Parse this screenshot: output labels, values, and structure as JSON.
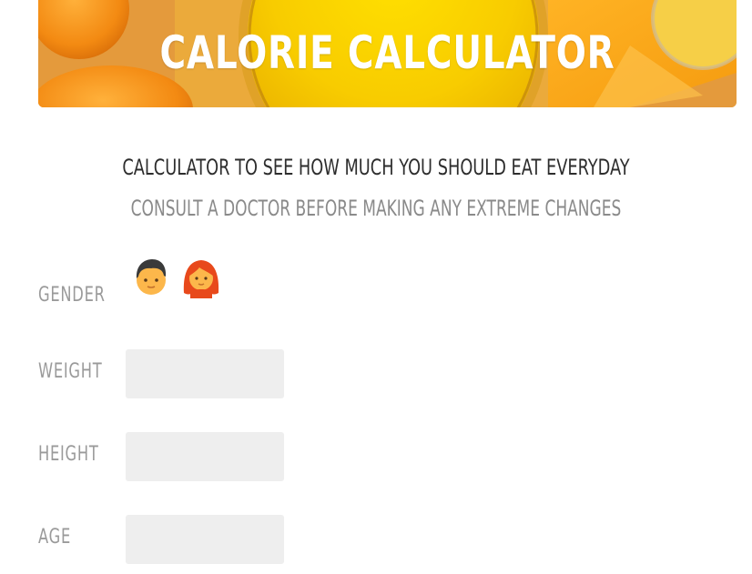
{
  "header": {
    "title": "CALORIE CALCULATOR"
  },
  "intro": {
    "headline": "CALCULATOR TO SEE HOW MUCH YOU SHOULD EAT EVERYDAY",
    "warning": "CONSULT A DOCTOR BEFORE MAKING ANY EXTREME CHANGES"
  },
  "form": {
    "gender": {
      "label": "GENDER",
      "options": [
        {
          "icon": "man-emoji-icon"
        },
        {
          "icon": "woman-emoji-icon"
        }
      ]
    },
    "weight": {
      "label": "WEIGHT",
      "value": ""
    },
    "height": {
      "label": "HEIGHT",
      "value": ""
    },
    "age": {
      "label": "AGE",
      "value": ""
    }
  },
  "colors": {
    "banner_orange": "#f3b11a",
    "banner_yellow": "#f7c600",
    "headline_text": "#2d2d2d",
    "muted_text": "#9a9a9a",
    "input_background": "#eeeeee"
  }
}
